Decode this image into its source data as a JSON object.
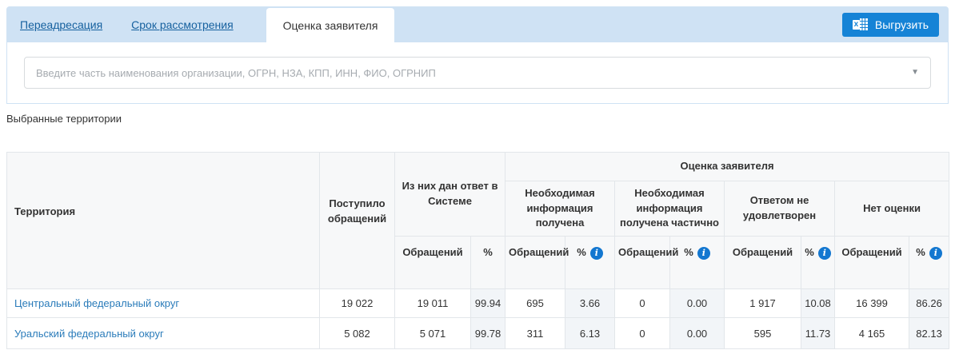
{
  "colors": {
    "panel_blue": "#cfe2f4",
    "button_blue": "#1583d6",
    "tab_link_blue": "#16619f",
    "territory_link_blue": "#2b7cba",
    "info_icon_blue": "#1377d0",
    "percent_cell_bg": "#f2f5f8"
  },
  "tabs": {
    "items": [
      {
        "label": "Переадресация",
        "active": false
      },
      {
        "label": "Срок рассмотрения",
        "active": false
      },
      {
        "label": "Оценка заявителя",
        "active": true
      }
    ]
  },
  "toolbar": {
    "export_label": "Выгрузить"
  },
  "search": {
    "placeholder": "Введите часть наименования организации, ОГРН, НЗА, КПП, ИНН, ФИО, ОГРНИП"
  },
  "section": {
    "selected_territories_label": "Выбранные территории"
  },
  "icons": {
    "excel_x": "x",
    "info": "i",
    "caret": "▼"
  },
  "table": {
    "headers": {
      "territory": "Территория",
      "received": "Поступило обращений",
      "answered_group": "Из них дан ответ в Системе",
      "rating_group": "Оценка заявителя",
      "subgroups": [
        "Необходимая информация получена",
        "Необходимая информация получена частично",
        "Ответом не удовлетворен",
        "Нет оценки"
      ],
      "appeals": "Обращений",
      "percent": "%"
    },
    "rows": [
      {
        "territory": "Центральный федеральный округ",
        "values": [
          "19 022",
          "19 011",
          "99.94",
          "695",
          "3.66",
          "0",
          "0.00",
          "1 917",
          "10.08",
          "16 399",
          "86.26"
        ]
      },
      {
        "territory": "Уральский федеральный округ",
        "values": [
          "5 082",
          "5 071",
          "99.78",
          "311",
          "6.13",
          "0",
          "0.00",
          "595",
          "11.73",
          "4 165",
          "82.13"
        ]
      }
    ]
  }
}
